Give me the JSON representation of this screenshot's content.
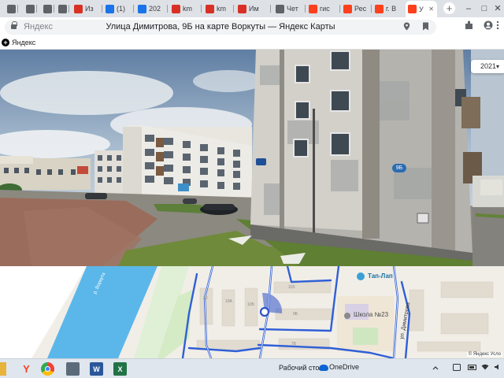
{
  "browser": {
    "tabs": [
      {
        "label": "",
        "favicon": "page-icon",
        "color": "#5f6368"
      },
      {
        "label": "",
        "favicon": "page-icon",
        "color": "#5f6368"
      },
      {
        "label": "",
        "favicon": "page-icon",
        "color": "#5f6368"
      },
      {
        "label": "",
        "favicon": "page-icon",
        "color": "#5f6368"
      },
      {
        "label": "Из",
        "favicon": "rbc-icon",
        "color": "#d93025"
      },
      {
        "label": "(1)",
        "favicon": "mail-icon",
        "color": "#1a73e8"
      },
      {
        "label": "202",
        "favicon": "g-icon",
        "color": "#1a73e8"
      },
      {
        "label": "km",
        "favicon": "rbc-icon",
        "color": "#d93025"
      },
      {
        "label": "km",
        "favicon": "rbc-icon",
        "color": "#d93025"
      },
      {
        "label": "Им",
        "favicon": "rbc-icon",
        "color": "#d93025"
      },
      {
        "label": "Чет",
        "favicon": "page-icon",
        "color": "#5f6368"
      },
      {
        "label": "гис",
        "favicon": "yandex-icon",
        "color": "#fc3f1d"
      },
      {
        "label": "Рес",
        "favicon": "yandex-icon",
        "color": "#fc3f1d"
      },
      {
        "label": "г. В",
        "favicon": "yandex-icon",
        "color": "#fc3f1d"
      },
      {
        "label": "У",
        "favicon": "map-pin-icon",
        "color": "#fc3f1d",
        "active": true
      }
    ],
    "new_tab_label": "+",
    "window_buttons": {
      "minimize": "–",
      "maximize": "□",
      "close": "✕"
    },
    "omnibox": {
      "site": "Яндекс",
      "title": "Улица Димитрова, 9Б на карте Воркуты — Яндекс Карты"
    },
    "bookmarks": [
      {
        "label": "Яндекс"
      }
    ]
  },
  "panorama": {
    "year": "2021",
    "year_caret": "▾",
    "house_number": "9Б"
  },
  "map": {
    "river_label": "р. Воркута",
    "street_label": "ул. Димитрова",
    "poi_tap_lap": "Тап-Лап",
    "poi_school": "Школа №23",
    "building_labels": [
      "11Б",
      "10",
      "10А",
      "10Б",
      "9Б",
      "7Б"
    ],
    "copyright": "© Яндекс   Усло"
  },
  "taskbar": {
    "apps": [
      {
        "name": "yandex-browser-icon",
        "glyph": "Y",
        "color": "#fc3f1d"
      },
      {
        "name": "chrome-icon",
        "glyph": "",
        "color": "#4285f4"
      },
      {
        "name": "calculator-icon",
        "glyph": "",
        "color": "#5c6b7a"
      },
      {
        "name": "word-icon",
        "glyph": "W",
        "color": "#2b579a"
      },
      {
        "name": "excel-icon",
        "glyph": "X",
        "color": "#217346"
      }
    ],
    "desktop_label": "Рабочий стол",
    "onedrive_label": "OneDrive"
  }
}
